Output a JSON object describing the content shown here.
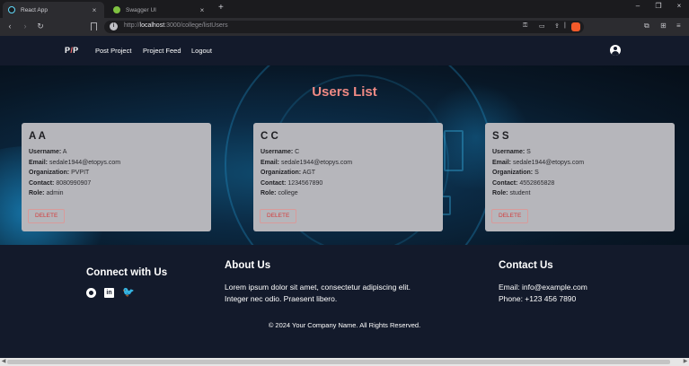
{
  "browser": {
    "tabs": [
      {
        "title": "React App",
        "active": true
      },
      {
        "title": "Swagger UI",
        "active": false
      }
    ],
    "new_tab": "+",
    "url_prefix": "http://",
    "url_host": "localhost",
    "url_path": ":3000/college/listUsers"
  },
  "app": {
    "brand_left": "P",
    "brand_mid": "/",
    "brand_right": "P",
    "nav": [
      "Post Project",
      "Project Feed",
      "Logout"
    ],
    "title": "Users List"
  },
  "users": [
    {
      "name": "A A",
      "username": "A",
      "email": "sedale1944@etopys.com",
      "organization": "PVPIT",
      "contact": "8080990907",
      "role": "admin"
    },
    {
      "name": "C C",
      "username": "C",
      "email": "sedale1944@etopys.com",
      "organization": "AGT",
      "contact": "1234567890",
      "role": "college"
    },
    {
      "name": "S S",
      "username": "S",
      "email": "sedale1944@etopys.com",
      "organization": "S",
      "contact": "4552865828",
      "role": "student"
    }
  ],
  "labels": {
    "username": "Username:",
    "email": "Email:",
    "organization": "Organization:",
    "contact": "Contact:",
    "role": "Role:",
    "delete": "DELETE"
  },
  "footer": {
    "connect_title": "Connect with Us",
    "about_title": "About Us",
    "about_line1": "Lorem ipsum dolor sit amet, consectetur adipiscing elit.",
    "about_line2": "Integer nec odio. Praesent libero.",
    "contact_title": "Contact Us",
    "email": "Email: info@example.com",
    "phone": "Phone: +123 456 7890",
    "copyright": "© 2024 Your Company Name. All Rights Reserved."
  },
  "colors": {
    "nav_bg": "#131a2b",
    "title": "#f08a84",
    "card_bg": "#b6b6bb",
    "delete": "#d33a3a"
  }
}
